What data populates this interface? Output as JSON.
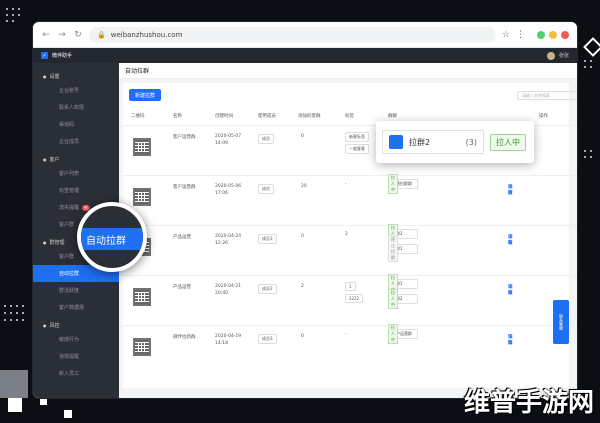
{
  "browser": {
    "url": "weibanzhushou.com"
  },
  "topbar": {
    "app_name": "微伴助手",
    "user": "张张"
  },
  "sidebar": {
    "groups": [
      {
        "label": "设置",
        "items": [
          "企业账号",
          "联系人权限",
          "渠道码",
          "企业成员"
        ]
      },
      {
        "label": "客户",
        "items": [
          "客户列表",
          "标签管理",
          "流失提醒",
          "客户群"
        ]
      },
      {
        "label": "群管理",
        "items": [
          "客户群",
          "自动拉群",
          "群活跃度",
          "客户数据报"
        ]
      },
      {
        "label": "风控",
        "items": [
          "敏感行为",
          "违规提醒",
          "新入员工"
        ]
      }
    ],
    "badge": "新",
    "active": "自动拉群"
  },
  "page": {
    "title": "自动拉群",
    "new_button": "新建拉群",
    "search_placeholder": "请输入名称搜索"
  },
  "table": {
    "headers": [
      "二维码",
      "名称",
      "创建时间",
      "使用成员",
      "添加的客群",
      "标签",
      "群聊",
      "操作"
    ],
    "rows": [
      {
        "name": "客户运营群",
        "date": "2020-05-07",
        "time": "14:09",
        "member": "成员",
        "count": "0",
        "tags": [
          "新客标签",
          "一般客客"
        ],
        "groups": [],
        "ops": []
      },
      {
        "name": "客户运营群",
        "date": "2020-05-06",
        "time": "17:06",
        "member": "成员",
        "count": "20",
        "tags": [
          "-"
        ],
        "groups": [
          {
            "name": "运营拉群群",
            "n": "(0)",
            "tag": "拉人中"
          }
        ],
        "ops": [
          "详情",
          "下载",
          "编辑"
        ]
      },
      {
        "name": "产品运营",
        "date": "2020-04-24",
        "time": "12:26",
        "member": "成员3",
        "count": "0",
        "tags": [
          "2"
        ],
        "groups": [
          {
            "name": "拉群2",
            "n": "(3)",
            "tag": "拉人中"
          },
          {
            "name": "拉群1",
            "n": "(0)",
            "tag": "停止拉群"
          }
        ],
        "ops": [
          "详情",
          "下载",
          "编辑"
        ]
      },
      {
        "name": "产品运营",
        "date": "2020-04-21",
        "time": "20:40",
        "member": "成员3",
        "count": "2",
        "tags": [
          "1",
          "2222"
        ],
        "groups": [
          {
            "name": "拉群1",
            "n": "(0)",
            "tag": "拉人中"
          },
          {
            "name": "拉群2",
            "n": "(2)",
            "tag": "拉人中"
          }
        ],
        "ops": [
          "详情",
          "下载",
          "编辑"
        ]
      },
      {
        "name": "微伴拉新群",
        "date": "2020-04-19",
        "time": "14:18",
        "member": "成员3",
        "count": "0",
        "tags": [
          "-"
        ],
        "groups": [
          {
            "name": "客户运营群",
            "n": "(0)",
            "tag": "拉人中"
          }
        ],
        "ops": [
          "详情",
          "下载",
          "编辑"
        ]
      }
    ]
  },
  "popup": {
    "name": "拉群2",
    "count": "(3)",
    "tag": "拉人中"
  },
  "magnifier": {
    "label": "自动拉群"
  },
  "float_button": {
    "label": "联系客服"
  },
  "watermark": "维普手游网"
}
